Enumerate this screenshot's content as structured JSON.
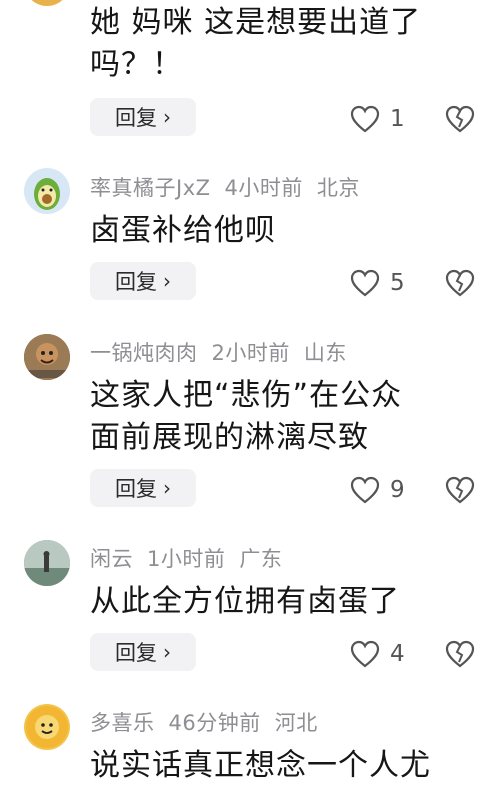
{
  "comments": [
    {
      "user": "",
      "time": "",
      "location": "",
      "text": "她 妈咪 这是想要出道了\n吗？！",
      "reply_label": "回复",
      "likes": "1"
    },
    {
      "user": "率真橘子JxZ",
      "time": "4小时前",
      "location": "北京",
      "text": "卤蛋补给他呗",
      "reply_label": "回复",
      "likes": "5"
    },
    {
      "user": "一锅炖肉肉",
      "time": "2小时前",
      "location": "山东",
      "text": "这家人把“悲伤”在公众\n面前展现的淋漓尽致",
      "reply_label": "回复",
      "likes": "9"
    },
    {
      "user": "闲云",
      "time": "1小时前",
      "location": "广东",
      "text": "从此全方位拥有卤蛋了",
      "reply_label": "回复",
      "likes": "4"
    },
    {
      "user": "多喜乐",
      "time": "46分钟前",
      "location": "河北",
      "text": "说实话真正想念一个人尤",
      "reply_label": "",
      "likes": ""
    }
  ],
  "colors": {
    "meta_text": "#8e8e93",
    "reply_bg": "#f2f2f4",
    "icon_stroke": "#555555"
  },
  "icons": [
    "heart-outline-icon",
    "broken-heart-icon",
    "chevron-right-icon"
  ]
}
